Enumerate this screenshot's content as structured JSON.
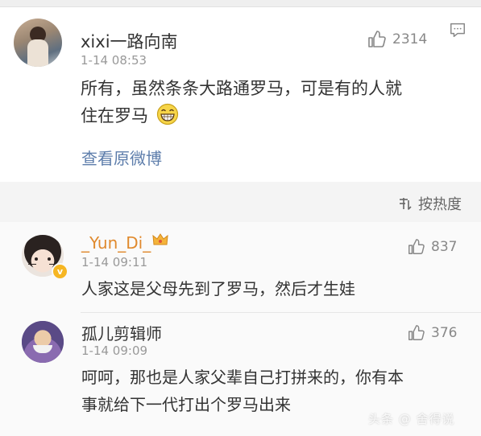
{
  "post": {
    "username": "xixi一路向南",
    "time": "1-14 08:53",
    "likes": "2314",
    "content_line1": "所有，虽然条条大路通罗马，可是有的人就",
    "content_line2": "住在罗马",
    "view_original": "查看原微博"
  },
  "sort": {
    "label": "按热度"
  },
  "comments": [
    {
      "username": "_Yun_Di_",
      "time": "1-14 09:11",
      "likes": "837",
      "content_line1": "人家这是父母先到了罗马，然后才生娃",
      "verified_badge": "v"
    },
    {
      "username": "孤儿剪辑师",
      "time": "1-14 09:09",
      "likes": "376",
      "content_line1": "呵呵，那也是人家父辈自己打拼来的，你有本",
      "content_line2": "事就给下一代打出个罗马出来"
    }
  ],
  "watermark": "头条 @ 舍得说",
  "colors": {
    "link": "#5d7dab",
    "meta": "#999999",
    "text": "#333333",
    "badge": "#f6b623"
  },
  "icons": [
    "thumbs-up-icon",
    "comment-icon",
    "sort-icon",
    "grin-emoji-icon",
    "crown-icon",
    "verified-badge-icon"
  ]
}
